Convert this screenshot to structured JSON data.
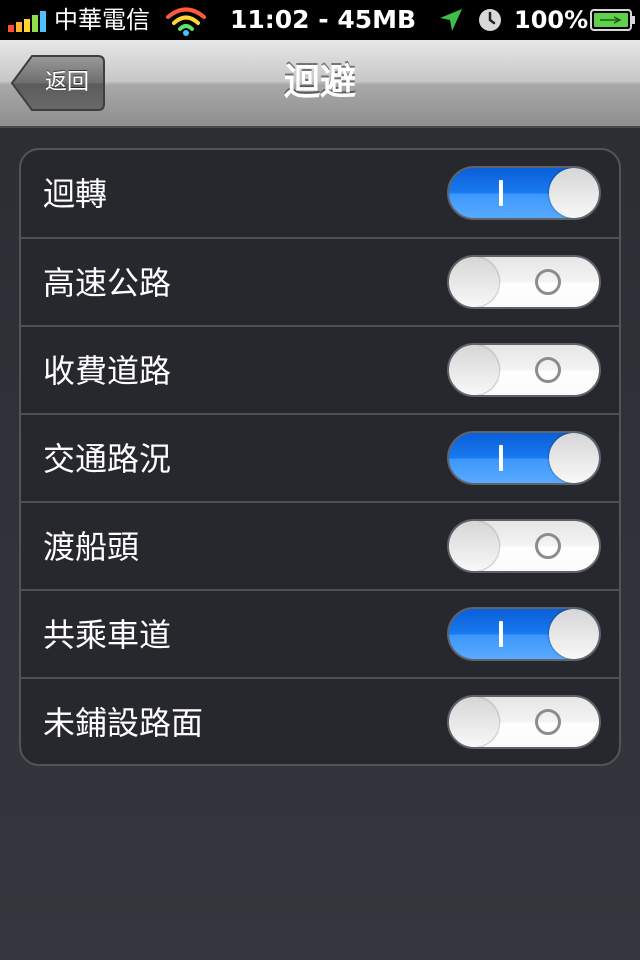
{
  "status_bar": {
    "carrier": "中華電信",
    "time_info": "11:02 - 45MB",
    "battery": "100%",
    "icons": [
      "signal-icon",
      "wifi-icon",
      "location-icon",
      "alarm-icon",
      "battery-icon"
    ]
  },
  "nav": {
    "back_label": "返回",
    "title": "迴避"
  },
  "settings": {
    "items": [
      {
        "label": "迴轉",
        "on": true
      },
      {
        "label": "高速公路",
        "on": false
      },
      {
        "label": "收費道路",
        "on": false
      },
      {
        "label": "交通路況",
        "on": true
      },
      {
        "label": "渡船頭",
        "on": false
      },
      {
        "label": "共乘車道",
        "on": true
      },
      {
        "label": "未鋪設路面",
        "on": false
      }
    ]
  },
  "colors": {
    "toggle_on": "#1a7af0",
    "toggle_off": "#ffffff",
    "group_background": "#26282d",
    "page_background": "#30333a"
  }
}
